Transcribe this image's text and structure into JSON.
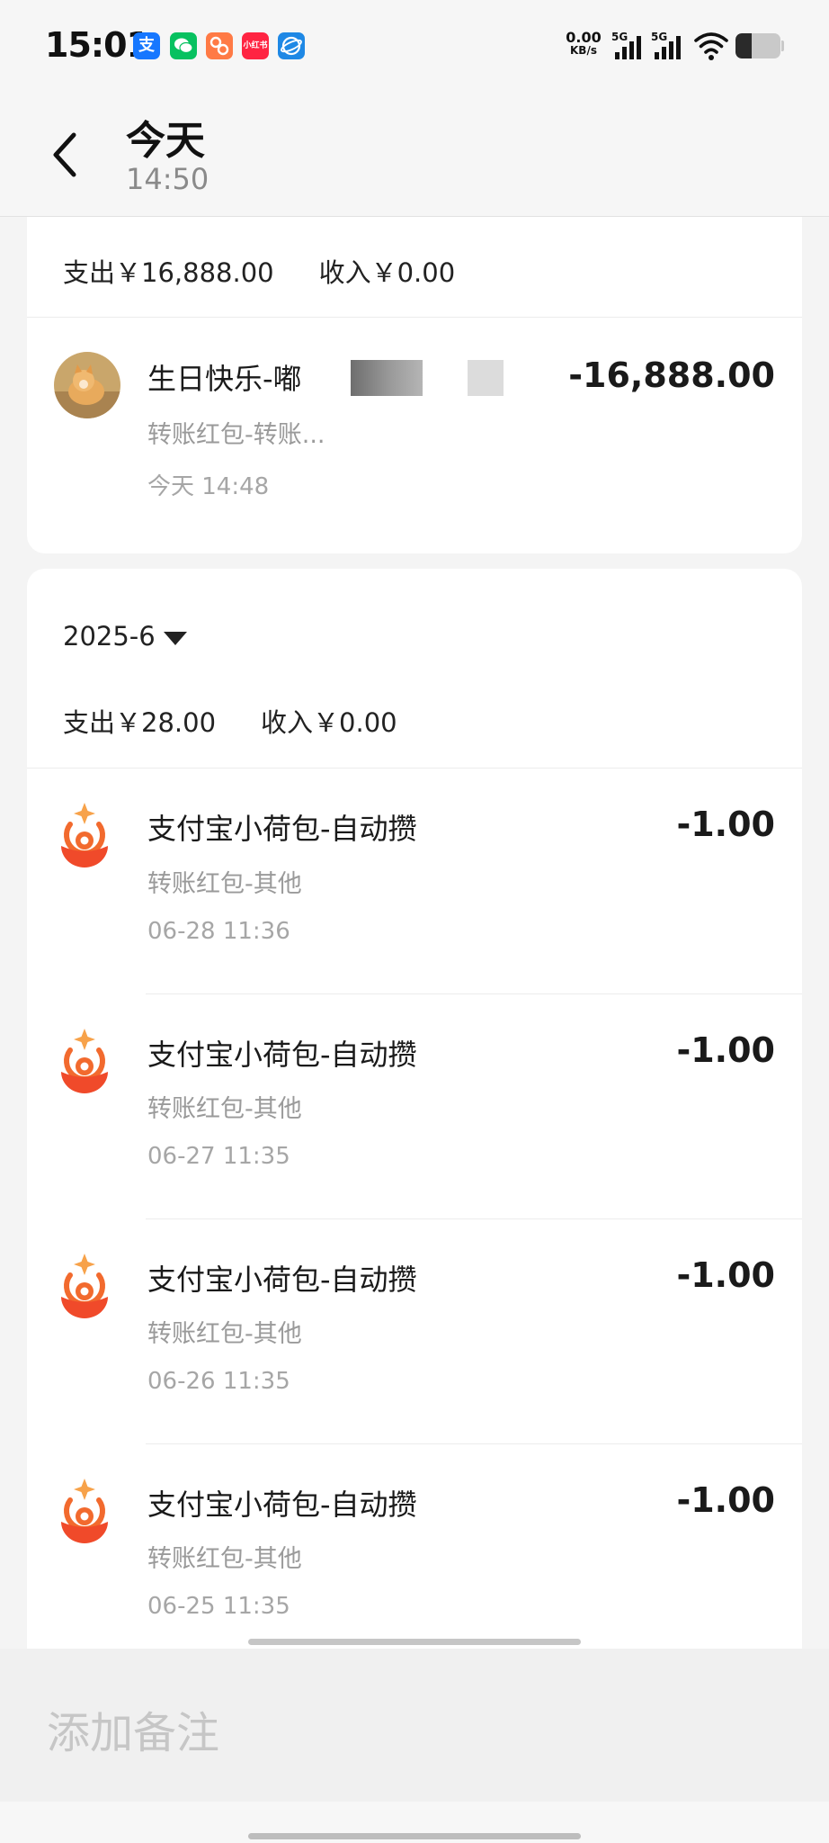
{
  "status_bar": {
    "time": "15:01",
    "net_speed_value": "0.00",
    "net_speed_unit": "KB/s",
    "signal_1": "5G",
    "signal_2": "5G",
    "battery_level": 0.35,
    "app_icons": [
      "alipay-icon",
      "wechat-icon",
      "app-icon",
      "xiaohongshu-icon",
      "browser-icon"
    ],
    "redbook_text": "小红书"
  },
  "header": {
    "title": "今天",
    "subtitle": "14:50"
  },
  "today_card": {
    "expense": "支出￥16,888.00",
    "income": "收入￥0.00",
    "transaction": {
      "title": "生日快乐-嘟",
      "category": "转账红包-转账...",
      "time": "今天 14:48",
      "amount": "-16,888.00"
    }
  },
  "month_card": {
    "month": "2025-6",
    "expense": "支出￥28.00",
    "income": "收入￥0.00",
    "transactions": [
      {
        "title": "支付宝小荷包-自动攒",
        "category": "转账红包-其他",
        "time": "06-28 11:36",
        "amount": "-1.00"
      },
      {
        "title": "支付宝小荷包-自动攒",
        "category": "转账红包-其他",
        "time": "06-27 11:35",
        "amount": "-1.00"
      },
      {
        "title": "支付宝小荷包-自动攒",
        "category": "转账红包-其他",
        "time": "06-26 11:35",
        "amount": "-1.00"
      },
      {
        "title": "支付宝小荷包-自动攒",
        "category": "转账红包-其他",
        "time": "06-25 11:35",
        "amount": "-1.00"
      }
    ]
  },
  "note_bar": {
    "placeholder": "添加备注"
  },
  "colors": {
    "background": "#f4f4f4",
    "card": "#ffffff",
    "icon_orange": "#f26a2e",
    "muted_text": "#9a9a9a"
  }
}
